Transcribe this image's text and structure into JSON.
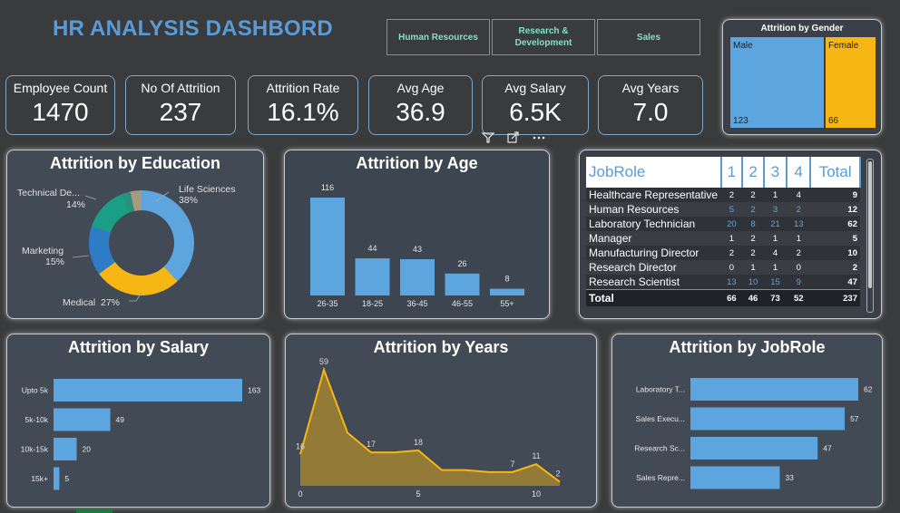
{
  "title": "HR ANALYSIS DASHBORD",
  "slicers": [
    "Human Resources",
    "Research & Development",
    "Sales"
  ],
  "kpis": [
    {
      "label": "Employee Count",
      "value": "1470"
    },
    {
      "label": "No Of Attrition",
      "value": "237"
    },
    {
      "label": "Attrition Rate",
      "value": "16.1%"
    },
    {
      "label": "Avg Age",
      "value": "36.9"
    },
    {
      "label": "Avg Salary",
      "value": "6.5K"
    },
    {
      "label": "Avg Years",
      "value": "7.0"
    }
  ],
  "gender": {
    "title": "Attrition by Gender",
    "male": {
      "label": "Male",
      "value": "123",
      "color": "#5da5de"
    },
    "female": {
      "label": "Female",
      "value": "66",
      "color": "#f6b613"
    }
  },
  "chart_data": [
    {
      "type": "pie",
      "title": "Attrition by Education",
      "slices": [
        {
          "label": "Life Sciences",
          "pct_label": "38%",
          "value": 38,
          "color": "#5da5de"
        },
        {
          "label": "Medical",
          "pct_label": "27%",
          "value": 27,
          "color": "#f6b613"
        },
        {
          "label": "Marketing",
          "pct_label": "15%",
          "value": 15,
          "color": "#2e7bc7"
        },
        {
          "label": "Technical De...",
          "pct_label": "14%",
          "value": 14,
          "color": "#1a9e86"
        },
        {
          "label": "",
          "pct_label": "",
          "value": 2.5,
          "color": "#2b8f7e"
        },
        {
          "label": "",
          "pct_label": "",
          "value": 3.5,
          "color": "#a89a7e"
        }
      ]
    },
    {
      "type": "bar",
      "title": "Attrition by Age",
      "categories": [
        "26-35",
        "18-25",
        "36-45",
        "46-55",
        "55+"
      ],
      "values": [
        116,
        44,
        43,
        26,
        8
      ],
      "ylim": [
        0,
        116
      ]
    },
    {
      "type": "table",
      "title": "JobRole",
      "columns": [
        "JobRole",
        "1",
        "2",
        "3",
        "4",
        "Total"
      ],
      "rows": [
        [
          "Healthcare Representative",
          "2",
          "2",
          "1",
          "4",
          "9"
        ],
        [
          "Human Resources",
          "5",
          "2",
          "3",
          "2",
          "12"
        ],
        [
          "Laboratory Technician",
          "20",
          "8",
          "21",
          "13",
          "62"
        ],
        [
          "Manager",
          "1",
          "2",
          "1",
          "1",
          "5"
        ],
        [
          "Manufacturing Director",
          "2",
          "2",
          "4",
          "2",
          "10"
        ],
        [
          "Research Director",
          "0",
          "1",
          "1",
          "0",
          "2"
        ],
        [
          "Research Scientist",
          "13",
          "10",
          "15",
          "9",
          "47"
        ]
      ],
      "total": [
        "Total",
        "66",
        "46",
        "73",
        "52",
        "237"
      ]
    },
    {
      "type": "bar",
      "orientation": "horizontal",
      "title": "Attrition by Salary",
      "categories": [
        "Upto 5k",
        "5k-10k",
        "10k-15k",
        "15k+"
      ],
      "values": [
        163,
        49,
        20,
        5
      ],
      "xlim": [
        0,
        163
      ]
    },
    {
      "type": "area",
      "title": "Attrition by Years",
      "x": [
        0,
        1,
        2,
        3,
        4,
        5,
        6,
        7,
        8,
        9,
        10,
        11
      ],
      "y": [
        16,
        59,
        27,
        17,
        17,
        18,
        8,
        8,
        7,
        7,
        11,
        2
      ],
      "point_labels": {
        "0": "16",
        "1": "59",
        "3": "17",
        "5": "18",
        "9": "7",
        "10": "11",
        "11": "2"
      },
      "xticks": [
        "0",
        "5",
        "10"
      ],
      "color": "#f6b613"
    },
    {
      "type": "bar",
      "orientation": "horizontal",
      "title": "Attrition by JobRole",
      "categories": [
        "Laboratory T...",
        "Sales Execu...",
        "Research Sc...",
        "Sales Repre..."
      ],
      "values": [
        62,
        57,
        47,
        33
      ],
      "xlim": [
        0,
        62
      ]
    }
  ]
}
